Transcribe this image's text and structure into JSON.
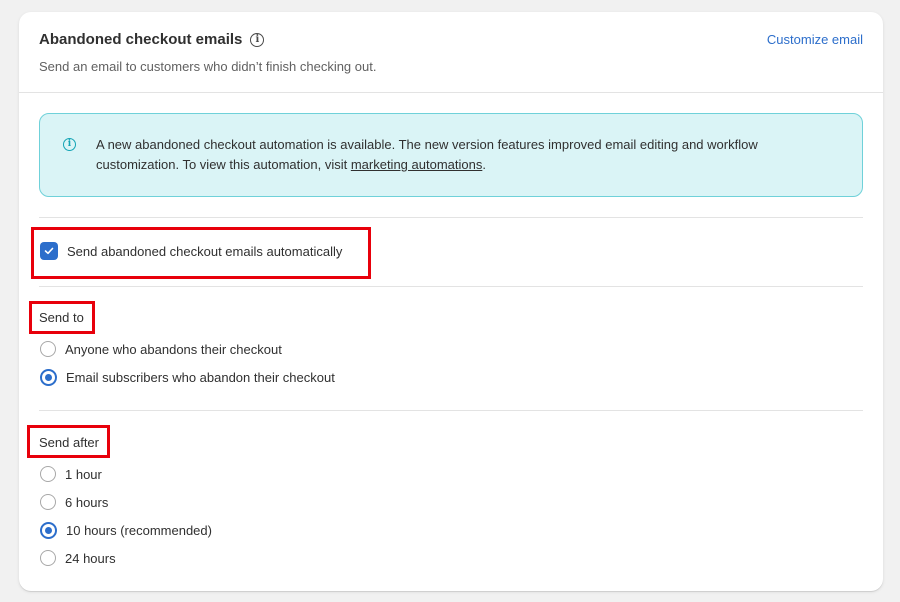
{
  "card": {
    "title": "Abandoned checkout emails",
    "subtitle": "Send an email to customers who didn’t finish checking out.",
    "customize_link": "Customize email",
    "title_icon": "info-icon"
  },
  "banner": {
    "icon": "info-icon",
    "text_before": "A new abandoned checkout automation is available. The new version features improved email editing and workflow customization. To view this automation, visit ",
    "link_text": "marketing automations",
    "text_after": "."
  },
  "auto_send": {
    "label": "Send abandoned checkout emails automatically",
    "checked": true
  },
  "send_to": {
    "label": "Send to",
    "options": [
      {
        "label": "Anyone who abandons their checkout",
        "selected": false
      },
      {
        "label": "Email subscribers who abandon their checkout",
        "selected": true
      }
    ]
  },
  "send_after": {
    "label": "Send after",
    "options": [
      {
        "label": "1 hour",
        "selected": false
      },
      {
        "label": "6 hours",
        "selected": false
      },
      {
        "label": "10 hours (recommended)",
        "selected": true
      },
      {
        "label": "24 hours",
        "selected": false
      }
    ]
  },
  "colors": {
    "accent": "#2c6ecb",
    "highlight": "#e8000b",
    "banner_bg": "#daf4f6",
    "banner_border": "#6fd1d9"
  }
}
